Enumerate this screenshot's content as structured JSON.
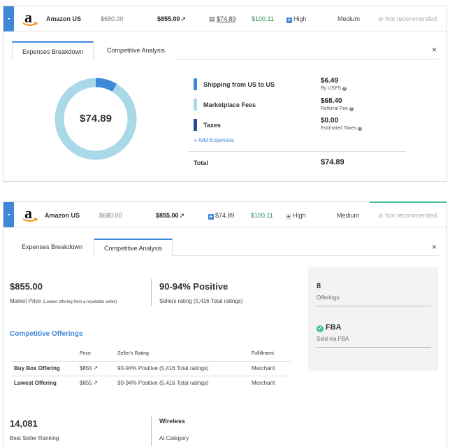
{
  "row": {
    "toggle_symbol": "-",
    "store": "Amazon US",
    "price": "$680.00",
    "market_price": "$855.00",
    "expenses": "$74.89",
    "profit": "$100.11",
    "demand": "High",
    "competition": "Medium",
    "recommendation": "Not recommended"
  },
  "tabs": {
    "expenses": "Expenses Breakdown",
    "competitive": "Competitive Analysis",
    "close": "×"
  },
  "expenses": {
    "total_center": "$74.89",
    "donut": [
      {
        "name": "Shipping from US to US",
        "value": 6.49,
        "color": "#3f88d8"
      },
      {
        "name": "Marketplace Fees",
        "value": 68.4,
        "color": "#a9d8e8"
      },
      {
        "name": "Taxes",
        "value": 0.0,
        "color": "#1f4e9b"
      }
    ],
    "items": [
      {
        "label": "Shipping from US to US",
        "amount": "$6.49",
        "sub": "By USPS"
      },
      {
        "label": "Marketplace Fees",
        "amount": "$68.40",
        "sub": "Referral Fee"
      },
      {
        "label": "Taxes",
        "amount": "$0.00",
        "sub": "Estimated Taxes"
      }
    ],
    "add_link": "+ Add Expenses",
    "total_label": "Total",
    "total_value": "$74.89",
    "info_glyph": "?"
  },
  "competitive": {
    "market_price": "$855.00",
    "market_price_label": "Market Price",
    "market_price_note": "(Lowest offering from a reputable seller)",
    "seller_rating": "90-94% Positive",
    "seller_rating_label": "Sellers rating (5,416 Total ratings)",
    "offerings_count": "8",
    "offerings_label": "Offerings",
    "fba_check": "✓",
    "fba": "FBA",
    "fba_label": "Sold via FBA",
    "section_title": "Competitive Offerings",
    "table": {
      "headers": [
        "",
        "Price",
        "Seller's Rating",
        "Fulfillment"
      ],
      "rows": [
        [
          "Buy Box Offering",
          "$855",
          "90-94% Positive (5,416 Total ratings)",
          "Merchant"
        ],
        [
          "Lowest Offering",
          "$855",
          "90-94% Positive (5,416 Total ratings)",
          "Merchant"
        ]
      ]
    },
    "rank": "14,081",
    "rank_label": "Best Seller Ranking",
    "category": "Wireless",
    "category_label": "At Category"
  }
}
